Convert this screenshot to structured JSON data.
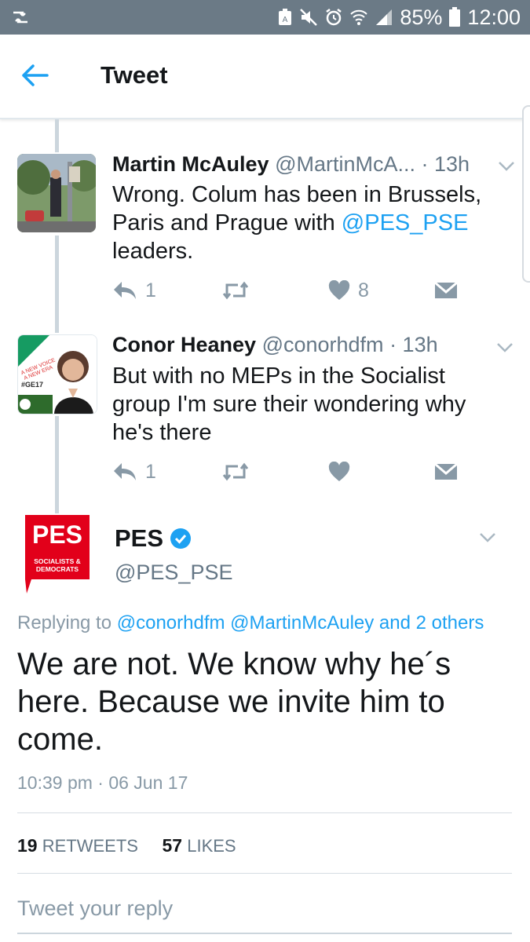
{
  "status_bar": {
    "battery": "85%",
    "time": "12:00"
  },
  "header": {
    "title": "Tweet"
  },
  "thread": [
    {
      "name": "Martin McAuley",
      "handle": "@MartinMcA...",
      "time": "· 13h",
      "text_lines": [
        "Wrong. Colum has been in Brussels,",
        "Paris and Prague with ",
        "@PES_PSE",
        "leaders."
      ],
      "replies": "1",
      "likes": "8"
    },
    {
      "name": "Conor Heaney",
      "handle": "@conorhdfm",
      "time": "· 13h",
      "text": "But with no MEPs in the Socialist group I'm sure their wondering why he's there",
      "replies": "1",
      "avatar_text": {
        "line1": "A NEW VOICE",
        "line2": "A NEW ERA",
        "tag": "#GE17"
      }
    }
  ],
  "main_tweet": {
    "avatar": {
      "logo": "PES",
      "line1": "SOCIALISTS &",
      "line2": "DEMOCRATS",
      "color": "#e2001a"
    },
    "name": "PES",
    "handle": "@PES_PSE",
    "replying_label": "Replying to",
    "replying_to": "@conorhdfm @MartinMcAuley and 2 others",
    "text": "We are not. We know why he´s here. Because we invite him to come.",
    "timestamp": "10:39 pm · 06 Jun 17",
    "retweets_count": "19",
    "retweets_label": "RETWEETS",
    "likes_count": "57",
    "likes_label": "LIKES"
  },
  "reply_input": {
    "placeholder": "Tweet your reply"
  },
  "colors": {
    "link": "#1da1f2",
    "status_bar": "#6b7a86",
    "verified": "#1da1f2"
  }
}
